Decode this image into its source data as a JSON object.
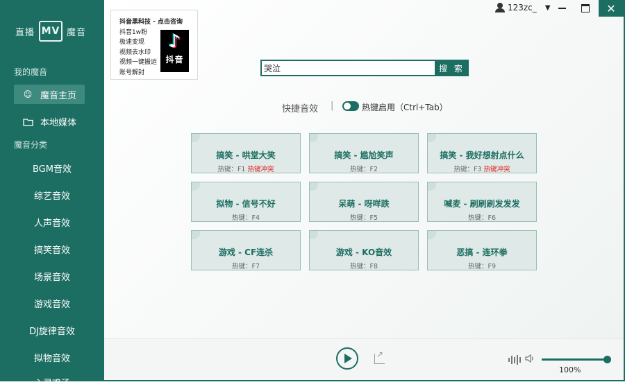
{
  "app": {
    "logo_left": "直播",
    "logo_mark": "MV",
    "logo_right": "魔音"
  },
  "titlebar": {
    "username": "123zc_",
    "close_label": "✕"
  },
  "sidebar": {
    "section_mine": "我的魔音",
    "home_label": "魔音主页",
    "local_label": "本地媒体",
    "section_categories": "魔音分类",
    "categories": [
      "BGM音效",
      "综艺音效",
      "人声音效",
      "搞笑音效",
      "场景音效",
      "游戏音效",
      "DJ旋律音效",
      "拟物音效",
      "心灵鸡汤"
    ]
  },
  "ad": {
    "lines": [
      "抖音黑科技 - 点击咨询",
      "抖音1w粉",
      "极速变现",
      "视频去水印",
      "视频一键搬运",
      "账号解封"
    ],
    "badge_text": "抖音"
  },
  "search": {
    "value": "哭泣",
    "button_label": "搜 索"
  },
  "quick": {
    "label": "快捷音效",
    "separator": "|",
    "hotkey_label": "热键启用（Ctrl+Tab）",
    "hotkey_enabled": true
  },
  "tiles": [
    {
      "title": "搞笑 - 哄堂大笑",
      "hotkey": "热键：F1",
      "conflict": "热键冲突"
    },
    {
      "title": "搞笑 - 尴尬笑声",
      "hotkey": "热键：F2",
      "conflict": ""
    },
    {
      "title": "搞笑 - 我好想射点什么",
      "hotkey": "热键：F3",
      "conflict": "热键冲突"
    },
    {
      "title": "拟物 - 信号不好",
      "hotkey": "热键：F4",
      "conflict": ""
    },
    {
      "title": "呆萌 - 呀咩跌",
      "hotkey": "热键：F5",
      "conflict": ""
    },
    {
      "title": "喊麦 - 刷刷刷发发发",
      "hotkey": "热键：F6",
      "conflict": ""
    },
    {
      "title": "游戏 - CF连杀",
      "hotkey": "热键：F7",
      "conflict": ""
    },
    {
      "title": "游戏 - KO音效",
      "hotkey": "热键：F8",
      "conflict": ""
    },
    {
      "title": "恶搞 - 连环拳",
      "hotkey": "热键：F9",
      "conflict": ""
    }
  ],
  "player": {
    "volume_label": "100%",
    "volume_level": 1.0
  },
  "colors": {
    "brand": "#1c6e62",
    "conflict": "#e02020"
  }
}
